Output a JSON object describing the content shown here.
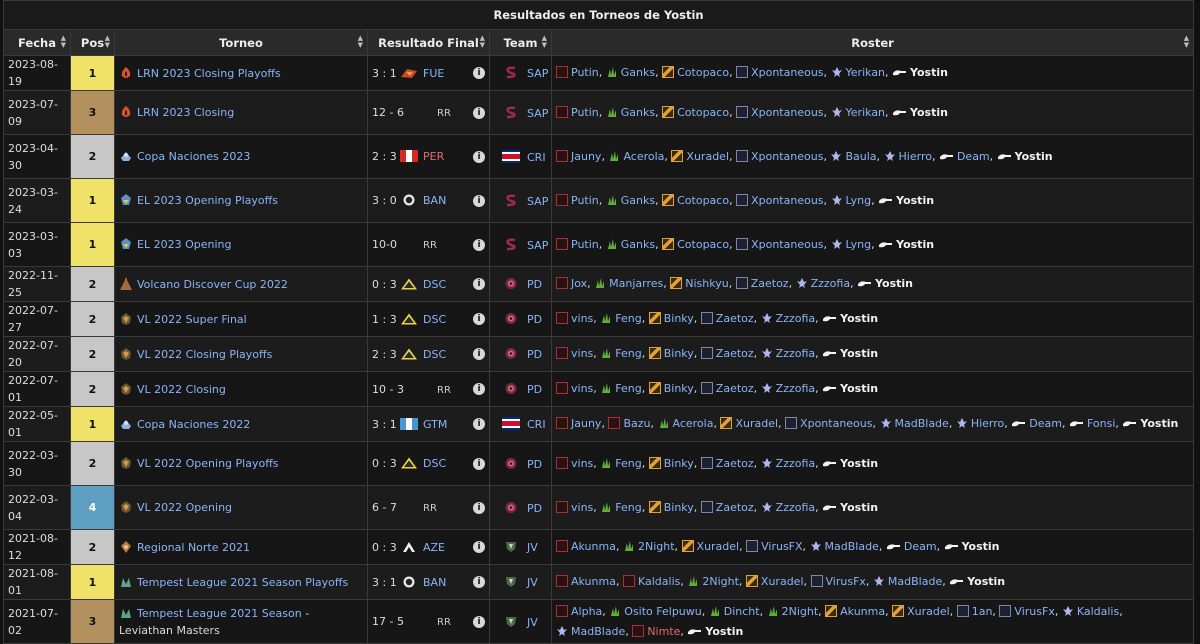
{
  "title": "Resultados en Torneos de Yostin",
  "columns": {
    "date": "Fecha",
    "pos": "Pos",
    "tournament": "Torneo",
    "result": "Resultado Final",
    "team": "Team",
    "roster": "Roster"
  },
  "colors": {
    "pos1": "#f0e169",
    "pos2": "#c7c7c7",
    "pos3": "#b2915f",
    "pos4": "#5e9ec0",
    "link": "#8ab4f8",
    "highlight_player": "#f3f3f3"
  },
  "rows": [
    {
      "date": "2023-08-19",
      "pos": "1",
      "tournament": "LRN 2023 Closing Playoffs",
      "t_icon": "lrn-logo",
      "score": "3 : 1",
      "opp_icon": "fue-logo",
      "opp": "FUE",
      "team_icon": "sap-logo",
      "team": "SAP",
      "roster": [
        {
          "role": "top-icon",
          "name": "Putin"
        },
        {
          "role": "jungle-icon",
          "name": "Ganks"
        },
        {
          "role": "mid-icon",
          "name": "Cotopaco"
        },
        {
          "role": "adc-icon",
          "name": "Xpontaneous"
        },
        {
          "role": "support-icon",
          "name": "Yerikan"
        },
        {
          "role": "coach-icon",
          "name": "Yostin"
        }
      ]
    },
    {
      "date": "2023-07-09",
      "pos": "3",
      "tournament": "LRN 2023 Closing",
      "t_icon": "lrn-logo",
      "score": "12 - 6",
      "opp_icon": "",
      "opp": "RR",
      "team_icon": "sap-logo",
      "team": "SAP",
      "roster": [
        {
          "role": "top-icon",
          "name": "Putin"
        },
        {
          "role": "jungle-icon",
          "name": "Ganks"
        },
        {
          "role": "mid-icon",
          "name": "Cotopaco"
        },
        {
          "role": "adc-icon",
          "name": "Xpontaneous"
        },
        {
          "role": "support-icon",
          "name": "Yerikan"
        },
        {
          "role": "coach-icon",
          "name": "Yostin"
        }
      ]
    },
    {
      "date": "2023-04-30",
      "pos": "2",
      "tournament": "Copa Naciones 2023",
      "t_icon": "copa-logo",
      "score": "2 : 3",
      "opp_icon": "peru-flag",
      "opp": "PER",
      "team_icon": "costa-rica-flag",
      "team": "CRI",
      "roster": [
        {
          "role": "top-icon",
          "name": "Jauny"
        },
        {
          "role": "jungle-icon",
          "name": "Acerola"
        },
        {
          "role": "mid-icon",
          "name": "Xuradel"
        },
        {
          "role": "adc-icon",
          "name": "Xpontaneous"
        },
        {
          "role": "support-icon",
          "name": "Baula"
        },
        {
          "role": "support-icon",
          "name": "Hierro"
        },
        {
          "role": "coach-icon",
          "name": "Deam"
        },
        {
          "role": "coach-icon",
          "name": "Yostin"
        }
      ]
    },
    {
      "date": "2023-03-24",
      "pos": "1",
      "tournament": "EL 2023 Opening Playoffs",
      "t_icon": "el-logo",
      "score": "3 : 0",
      "opp_icon": "ban-logo",
      "opp": "BAN",
      "team_icon": "sap-logo",
      "team": "SAP",
      "roster": [
        {
          "role": "top-icon",
          "name": "Putin"
        },
        {
          "role": "jungle-icon",
          "name": "Ganks"
        },
        {
          "role": "mid-icon",
          "name": "Cotopaco"
        },
        {
          "role": "adc-icon",
          "name": "Xpontaneous"
        },
        {
          "role": "support-icon",
          "name": "Lyng"
        },
        {
          "role": "coach-icon",
          "name": "Yostin"
        }
      ]
    },
    {
      "date": "2023-03-03",
      "pos": "1",
      "tournament": "EL 2023 Opening",
      "t_icon": "el-logo",
      "score": "10-0",
      "opp_icon": "",
      "opp": "RR",
      "team_icon": "sap-logo",
      "team": "SAP",
      "roster": [
        {
          "role": "top-icon",
          "name": "Putin"
        },
        {
          "role": "jungle-icon",
          "name": "Ganks"
        },
        {
          "role": "mid-icon",
          "name": "Cotopaco"
        },
        {
          "role": "adc-icon",
          "name": "Xpontaneous"
        },
        {
          "role": "support-icon",
          "name": "Lyng"
        },
        {
          "role": "coach-icon",
          "name": "Yostin"
        }
      ]
    },
    {
      "date": "2022-11-25",
      "pos": "2",
      "tournament": "Volcano Discover Cup 2022",
      "t_icon": "volcano-logo",
      "score": "0 : 3",
      "opp_icon": "dsc-logo",
      "opp": "DSC",
      "team_icon": "pd-logo",
      "team": "PD",
      "roster": [
        {
          "role": "top-icon",
          "name": "Jox"
        },
        {
          "role": "jungle-icon",
          "name": "Manjarres"
        },
        {
          "role": "mid-icon",
          "name": "Nishkyu"
        },
        {
          "role": "adc-icon",
          "name": "Zaetoz"
        },
        {
          "role": "support-icon",
          "name": "Zzzofia"
        },
        {
          "role": "coach-icon",
          "name": "Yostin"
        }
      ]
    },
    {
      "date": "2022-07-27",
      "pos": "2",
      "tournament": "VL 2022 Super Final",
      "t_icon": "vl-logo",
      "score": "1 : 3",
      "opp_icon": "dsc-logo",
      "opp": "DSC",
      "team_icon": "pd-logo",
      "team": "PD",
      "roster": [
        {
          "role": "top-icon",
          "name": "vins"
        },
        {
          "role": "jungle-icon",
          "name": "Feng"
        },
        {
          "role": "mid-icon",
          "name": "Binky"
        },
        {
          "role": "adc-icon",
          "name": "Zaetoz"
        },
        {
          "role": "support-icon",
          "name": "Zzzofia"
        },
        {
          "role": "coach-icon",
          "name": "Yostin"
        }
      ]
    },
    {
      "date": "2022-07-20",
      "pos": "2",
      "tournament": "VL 2022 Closing Playoffs",
      "t_icon": "vl-logo",
      "score": "2 : 3",
      "opp_icon": "dsc-logo",
      "opp": "DSC",
      "team_icon": "pd-logo",
      "team": "PD",
      "roster": [
        {
          "role": "top-icon",
          "name": "vins"
        },
        {
          "role": "jungle-icon",
          "name": "Feng"
        },
        {
          "role": "mid-icon",
          "name": "Binky"
        },
        {
          "role": "adc-icon",
          "name": "Zaetoz"
        },
        {
          "role": "support-icon",
          "name": "Zzzofia"
        },
        {
          "role": "coach-icon",
          "name": "Yostin"
        }
      ]
    },
    {
      "date": "2022-07-01",
      "pos": "2",
      "tournament": "VL 2022 Closing",
      "t_icon": "vl-logo",
      "score": "10 - 3",
      "opp_icon": "",
      "opp": "RR",
      "team_icon": "pd-logo",
      "team": "PD",
      "roster": [
        {
          "role": "top-icon",
          "name": "vins"
        },
        {
          "role": "jungle-icon",
          "name": "Feng"
        },
        {
          "role": "mid-icon",
          "name": "Binky"
        },
        {
          "role": "adc-icon",
          "name": "Zaetoz"
        },
        {
          "role": "support-icon",
          "name": "Zzzofia"
        },
        {
          "role": "coach-icon",
          "name": "Yostin"
        }
      ]
    },
    {
      "date": "2022-05-01",
      "pos": "1",
      "tournament": "Copa Naciones 2022",
      "t_icon": "copa-logo",
      "score": "3 : 1",
      "opp_icon": "guatemala-flag",
      "opp": "GTM",
      "team_icon": "costa-rica-flag",
      "team": "CRI",
      "roster": [
        {
          "role": "top-icon",
          "name": "Jauny"
        },
        {
          "role": "top-icon",
          "name": "Bazu"
        },
        {
          "role": "jungle-icon",
          "name": "Acerola"
        },
        {
          "role": "mid-icon",
          "name": "Xuradel"
        },
        {
          "role": "adc-icon",
          "name": "Xpontaneous"
        },
        {
          "role": "support-icon",
          "name": "MadBlade"
        },
        {
          "role": "support-icon",
          "name": "Hierro"
        },
        {
          "role": "coach-icon",
          "name": "Deam"
        },
        {
          "role": "coach-icon",
          "name": "Fonsi"
        },
        {
          "role": "coach-icon",
          "name": "Yostin"
        }
      ]
    },
    {
      "date": "2022-03-30",
      "pos": "2",
      "tournament": "VL 2022 Opening Playoffs",
      "t_icon": "vl-logo",
      "score": "0 : 3",
      "opp_icon": "dsc-logo",
      "opp": "DSC",
      "team_icon": "pd-logo",
      "team": "PD",
      "roster": [
        {
          "role": "top-icon",
          "name": "vins"
        },
        {
          "role": "jungle-icon",
          "name": "Feng"
        },
        {
          "role": "mid-icon",
          "name": "Binky"
        },
        {
          "role": "adc-icon",
          "name": "Zaetoz"
        },
        {
          "role": "support-icon",
          "name": "Zzzofia"
        },
        {
          "role": "coach-icon",
          "name": "Yostin"
        }
      ]
    },
    {
      "date": "2022-03-04",
      "pos": "4",
      "tournament": "VL 2022 Opening",
      "t_icon": "vl-logo",
      "score": "6 - 7",
      "opp_icon": "",
      "opp": "RR",
      "team_icon": "pd-logo",
      "team": "PD",
      "roster": [
        {
          "role": "top-icon",
          "name": "vins"
        },
        {
          "role": "jungle-icon",
          "name": "Feng"
        },
        {
          "role": "mid-icon",
          "name": "Binky"
        },
        {
          "role": "adc-icon",
          "name": "Zaetoz"
        },
        {
          "role": "support-icon",
          "name": "Zzzofia"
        },
        {
          "role": "coach-icon",
          "name": "Yostin"
        }
      ]
    },
    {
      "date": "2021-08-12",
      "pos": "2",
      "tournament": "Regional Norte 2021",
      "t_icon": "regional-norte-logo",
      "score": "0 : 3",
      "opp_icon": "aze-logo",
      "opp": "AZE",
      "team_icon": "jv-logo",
      "team": "JV",
      "roster": [
        {
          "role": "top-icon",
          "name": "Akunma"
        },
        {
          "role": "jungle-icon",
          "name": "2Night"
        },
        {
          "role": "mid-icon",
          "name": "Xuradel"
        },
        {
          "role": "adc-icon",
          "name": "VirusFX"
        },
        {
          "role": "support-icon",
          "name": "MadBlade"
        },
        {
          "role": "coach-icon",
          "name": "Deam"
        },
        {
          "role": "coach-icon",
          "name": "Yostin"
        }
      ]
    },
    {
      "date": "2021-08-01",
      "pos": "1",
      "tournament": "Tempest League 2021 Season Playoffs",
      "t_icon": "tempest-logo",
      "score": "3 : 1",
      "opp_icon": "ban-logo",
      "opp": "BAN",
      "team_icon": "jv-logo",
      "team": "JV",
      "roster": [
        {
          "role": "top-icon",
          "name": "Akunma"
        },
        {
          "role": "top-icon",
          "name": "Kaldalis"
        },
        {
          "role": "jungle-icon",
          "name": "2Night"
        },
        {
          "role": "mid-icon",
          "name": "Xuradel"
        },
        {
          "role": "adc-icon",
          "name": "VirusFx"
        },
        {
          "role": "support-icon",
          "name": "MadBlade"
        },
        {
          "role": "coach-icon",
          "name": "Yostin"
        }
      ]
    },
    {
      "date": "2021-07-02",
      "pos": "3",
      "tournament": "Tempest League 2021 Season",
      "tournament_suffix": "Leviathan Masters",
      "t_icon": "tempest-logo",
      "score": "17 - 5",
      "opp_icon": "",
      "opp": "RR",
      "team_icon": "jv-logo",
      "team": "JV",
      "roster": [
        {
          "role": "top-icon",
          "name": "Alpha"
        },
        {
          "role": "jungle-icon",
          "name": "Osito Felpuwu"
        },
        {
          "role": "jungle-icon",
          "name": "Dincht"
        },
        {
          "role": "jungle-icon",
          "name": "2Night"
        },
        {
          "role": "mid-icon",
          "name": "Akunma"
        },
        {
          "role": "mid-icon",
          "name": "Xuradel"
        },
        {
          "role": "adc-icon",
          "name": "1an"
        },
        {
          "role": "adc-icon",
          "name": "VirusFx"
        },
        {
          "role": "support-icon",
          "name": "Kaldalis"
        },
        {
          "role": "support-icon",
          "name": "MadBlade"
        },
        {
          "role": "top-icon",
          "name": "Nimte",
          "red": true
        },
        {
          "role": "coach-icon",
          "name": "Yostin"
        }
      ]
    }
  ],
  "rr_label": "RR",
  "sort_up": "▲",
  "sort_down": "▼",
  "info_glyph": "i",
  "highlight_name": "Yostin",
  "separator": ", "
}
